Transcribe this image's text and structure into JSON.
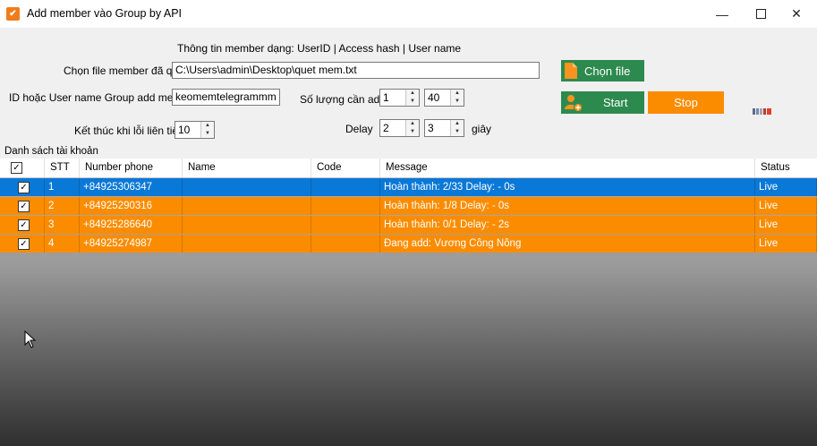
{
  "window": {
    "title": "Add member vào Group by API"
  },
  "form": {
    "info_text": "Thông tin member dạng: UserID | Access hash | User name",
    "file_label": "Chọn file member đã quét",
    "file_path": "C:\\Users\\admin\\Desktop\\quet mem.txt",
    "group_label": "ID hoặc User name Group add member",
    "group_value": "keomemtelegrammm",
    "qty_label": "Số lượng cần add",
    "qty_from": "1",
    "qty_to": "40",
    "stop_error_label": "Kết thúc khi lỗi liên tiếp",
    "stop_error_value": "10",
    "delay_label": "Delay",
    "delay_from": "2",
    "delay_to": "3",
    "delay_unit": "giây"
  },
  "buttons": {
    "choose_file": "Chọn file",
    "start": "Start",
    "stop": "Stop"
  },
  "colors": {
    "green": "#2d8a4e",
    "orange": "#fb8c00",
    "selected": "#0a78d7"
  },
  "list": {
    "title": "Danh sách tài khoản",
    "columns": [
      "STT",
      "Number phone",
      "Name",
      "Code",
      "Message",
      "Status"
    ],
    "rows": [
      {
        "stt": "1",
        "phone": "+84925306347",
        "name": "",
        "code": "",
        "message": "Hoàn thành: 2/33 Delay:  - 0s",
        "status": "Live",
        "selected": true
      },
      {
        "stt": "2",
        "phone": "+84925290316",
        "name": "",
        "code": "",
        "message": "Hoàn thành: 1/8 Delay:  - 0s",
        "status": "Live",
        "selected": false
      },
      {
        "stt": "3",
        "phone": "+84925286640",
        "name": "",
        "code": "",
        "message": "Hoàn thành: 0/1 Delay:  - 2s",
        "status": "Live",
        "selected": false
      },
      {
        "stt": "4",
        "phone": "+84925274987",
        "name": "",
        "code": "",
        "message": "Đang add: Vương Công Nông",
        "status": "Live",
        "selected": false
      }
    ]
  }
}
